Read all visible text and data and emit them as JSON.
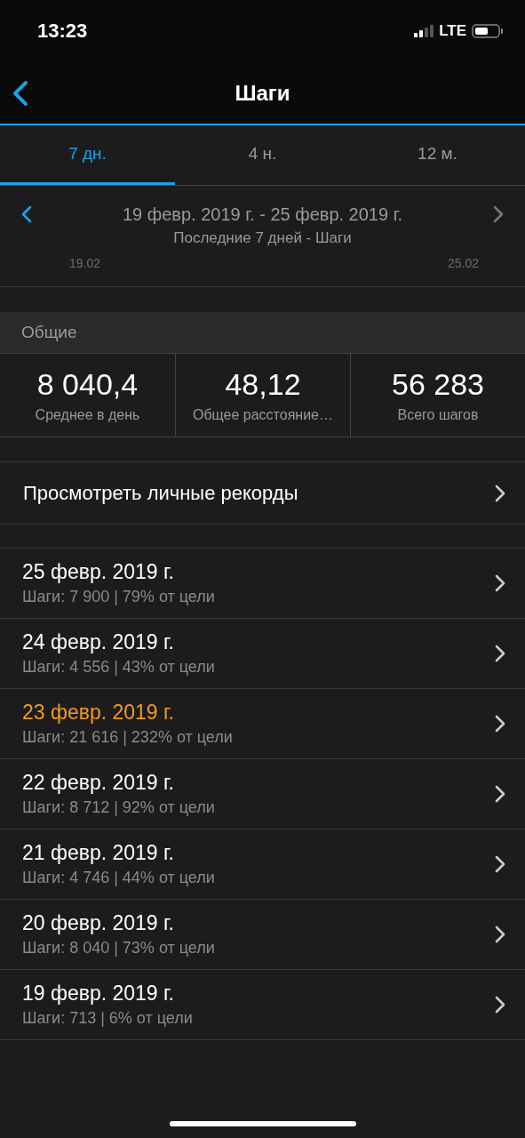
{
  "status_bar": {
    "time": "13:23",
    "network": "LTE"
  },
  "nav": {
    "title": "Шаги"
  },
  "tabs": [
    {
      "label": "7 дн.",
      "selected": true
    },
    {
      "label": "4 н.",
      "selected": false
    },
    {
      "label": "12 м.",
      "selected": false
    }
  ],
  "range": {
    "prev_disabled": false,
    "next_disabled": true,
    "title": "19 февр. 2019 г. - 25 февр. 2019 г.",
    "subtitle": "Последние 7 дней - Шаги",
    "start_label": "19.02",
    "end_label": "25.02"
  },
  "summary": {
    "header": "Общие",
    "stats": [
      {
        "value": "8 040,4",
        "label": "Среднее в день"
      },
      {
        "value": "48,12",
        "label": "Общее расстояние…"
      },
      {
        "value": "56 283",
        "label": "Всего шагов"
      }
    ]
  },
  "records_link": "Просмотреть личные рекорды",
  "days": [
    {
      "date": "25 февр. 2019 г.",
      "detail": "Шаги: 7 900 | 79% от цели",
      "highlighted": false
    },
    {
      "date": "24 февр. 2019 г.",
      "detail": "Шаги: 4 556 | 43% от цели",
      "highlighted": false
    },
    {
      "date": "23 февр. 2019 г.",
      "detail": "Шаги: 21 616 | 232% от цели",
      "highlighted": true
    },
    {
      "date": "22 февр. 2019 г.",
      "detail": "Шаги: 8 712 | 92% от цели",
      "highlighted": false
    },
    {
      "date": "21 февр. 2019 г.",
      "detail": "Шаги: 4 746 | 44% от цели",
      "highlighted": false
    },
    {
      "date": "20 февр. 2019 г.",
      "detail": "Шаги: 8 040 | 73% от цели",
      "highlighted": false
    },
    {
      "date": "19 февр. 2019 г.",
      "detail": "Шаги: 713 | 6% от цели",
      "highlighted": false
    }
  ]
}
